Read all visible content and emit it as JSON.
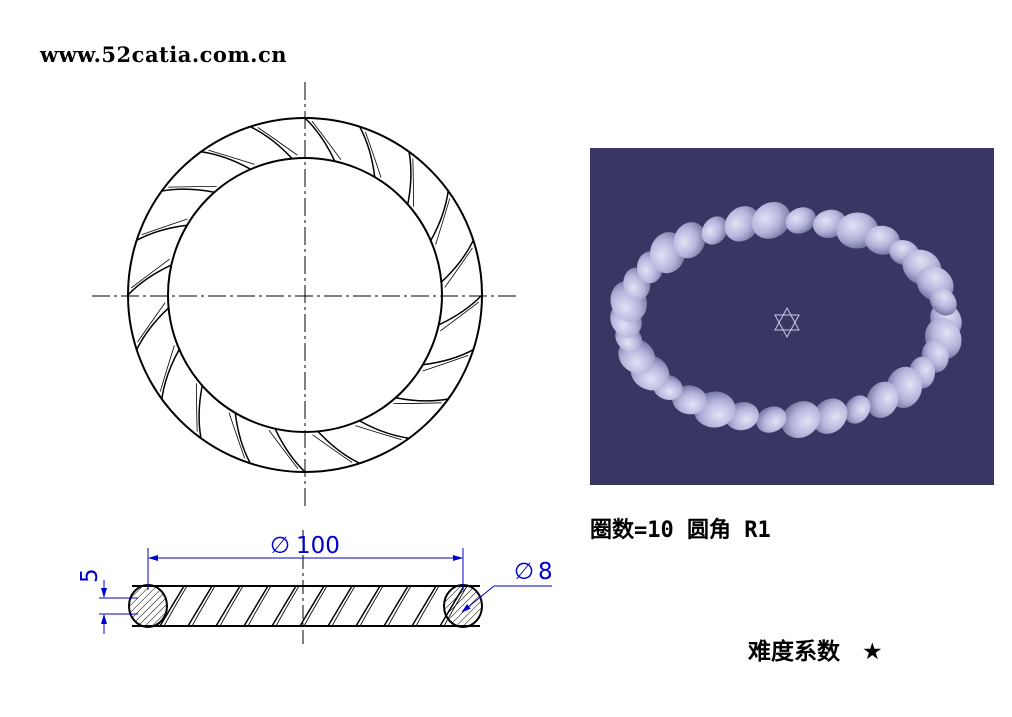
{
  "header": {
    "url_text": "www.52catia.com.cn"
  },
  "drawing": {
    "dim_diameter_main": "100",
    "dim_diameter_wire": "8",
    "dim_height": "5",
    "diameter_symbol": "∅"
  },
  "specs": {
    "params_text": "圈数=10 圆角 R1"
  },
  "footer": {
    "difficulty_label": "难度系数",
    "difficulty_stars": "★"
  },
  "colors": {
    "render_background": "#393664",
    "rope_color": "#b5b5dc",
    "dimension_color": "#0000cc"
  }
}
